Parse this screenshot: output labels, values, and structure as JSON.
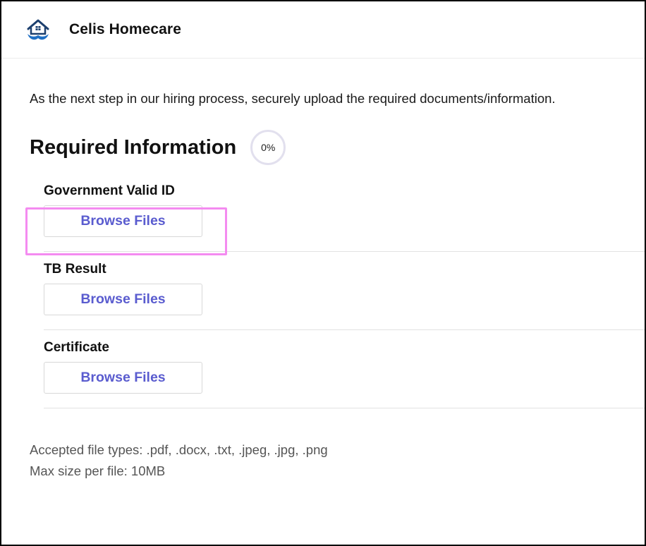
{
  "header": {
    "logo_icon": "house-heart-logo-icon",
    "brand_name": "Celis Homecare"
  },
  "intro_text": "As the next step in our hiring process, securely upload the required documents/information.",
  "required": {
    "title": "Required Information",
    "progress_label": "0%",
    "progress_value": 0
  },
  "uploads": [
    {
      "label": "Government Valid ID",
      "button_label": "Browse Files"
    },
    {
      "label": "TB Result",
      "button_label": "Browse Files"
    },
    {
      "label": "Certificate",
      "button_label": "Browse Files"
    }
  ],
  "footer": {
    "accepted_types": "Accepted file types: .pdf, .docx, .txt, .jpeg, .jpg, .png",
    "max_size": "Max size per file: 10MB"
  },
  "colors": {
    "accent": "#5a5ccf",
    "highlight": "#f48bf0",
    "logo_blue": "#1f6fc4",
    "logo_navy": "#1c3f6e"
  }
}
